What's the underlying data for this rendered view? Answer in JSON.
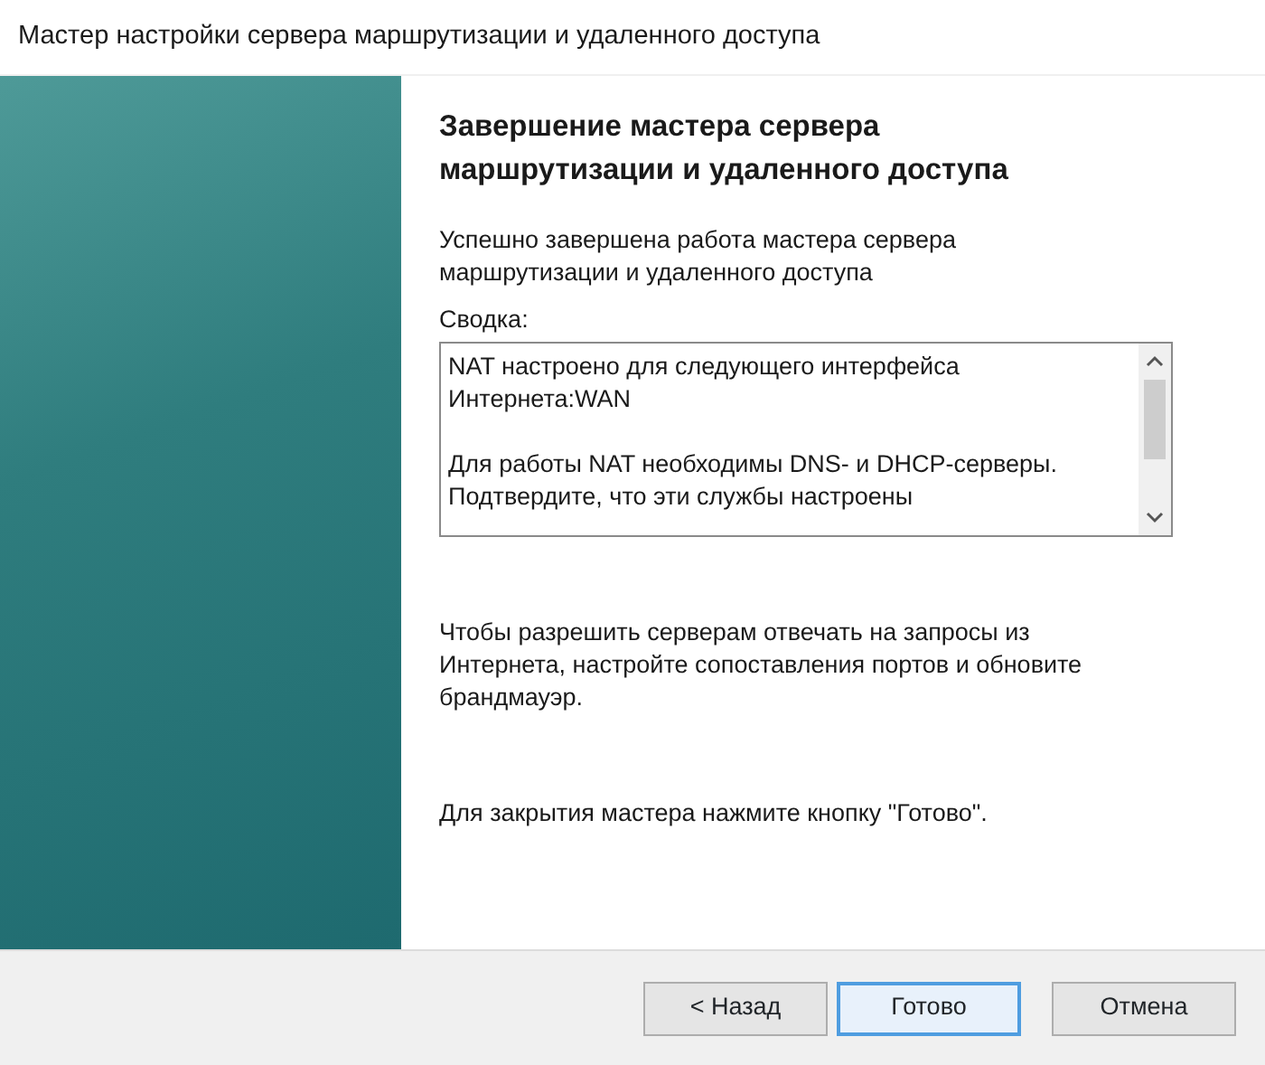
{
  "window": {
    "title": "Мастер настройки сервера маршрутизации и удаленного доступа"
  },
  "heading": "Завершение мастера сервера маршрутизации и удаленного доступа",
  "intro": "Успешно завершена работа мастера сервера маршрутизации и удаленного доступа",
  "summary": {
    "label": "Сводка:",
    "paragraphs": [
      "NAT настроено для следующего интерфейса Интернета:WAN",
      "Для работы NAT необходимы DNS- и DHCP-серверы. Подтвердите, что эти службы настроены"
    ]
  },
  "note": "Чтобы разрешить серверам отвечать на запросы из Интернета, настройте сопоставления портов и обновите брандмауэр.",
  "closing": "Для закрытия мастера нажмите кнопку \"Готово\".",
  "buttons": [
    {
      "label": "< Назад",
      "default": false
    },
    {
      "label": "Готово",
      "default": true
    },
    {
      "label": "Отмена",
      "default": false
    }
  ]
}
